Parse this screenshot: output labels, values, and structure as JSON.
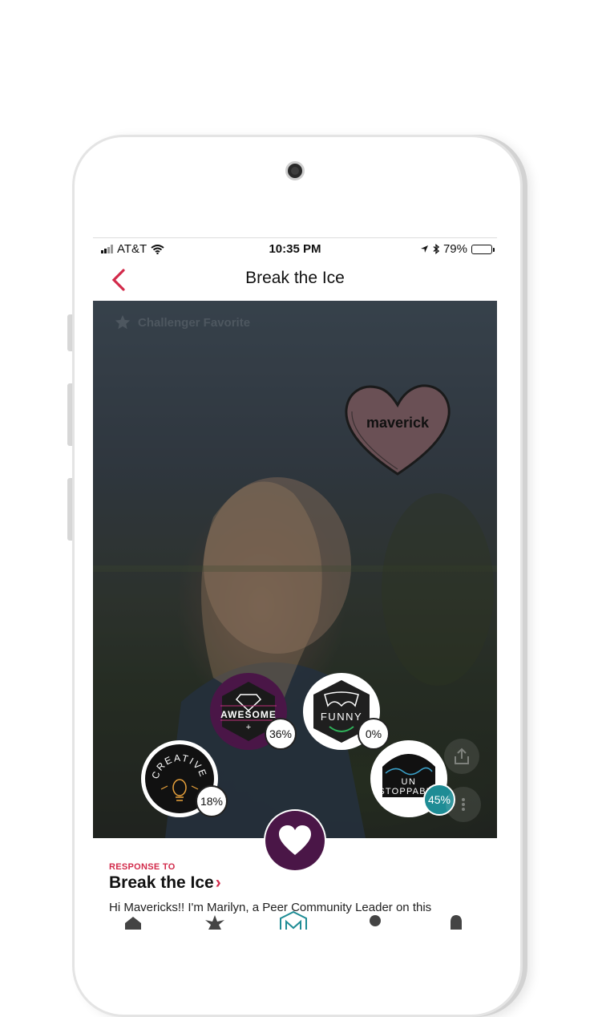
{
  "status_bar": {
    "carrier": "AT&T",
    "time": "10:35 PM",
    "battery": "79%",
    "battery_level": 0.79
  },
  "nav": {
    "title": "Break the Ice"
  },
  "photo": {
    "favorite_label": "Challenger Favorite",
    "sticker_text": "maverick"
  },
  "badges": [
    {
      "name": "AWESOME",
      "plus": "+",
      "percent": "36%",
      "color": "#4a1647"
    },
    {
      "name": "FUNNY",
      "percent": "0%",
      "color": "#222222"
    },
    {
      "name": "CREATIVE",
      "percent": "18%",
      "color": "#111111"
    },
    {
      "name_line1": "UN",
      "name_line2": "STOPPABLE",
      "percent": "45%",
      "color": "#1e8c95"
    }
  ],
  "response": {
    "label": "RESPONSE TO",
    "title": "Break the Ice",
    "text": "Hi Mavericks!! I'm Marilyn, a Peer Community Leader on this"
  },
  "colors": {
    "accent": "#d22a4a",
    "brand_purple": "#4a1647",
    "teal": "#1e8c95"
  }
}
